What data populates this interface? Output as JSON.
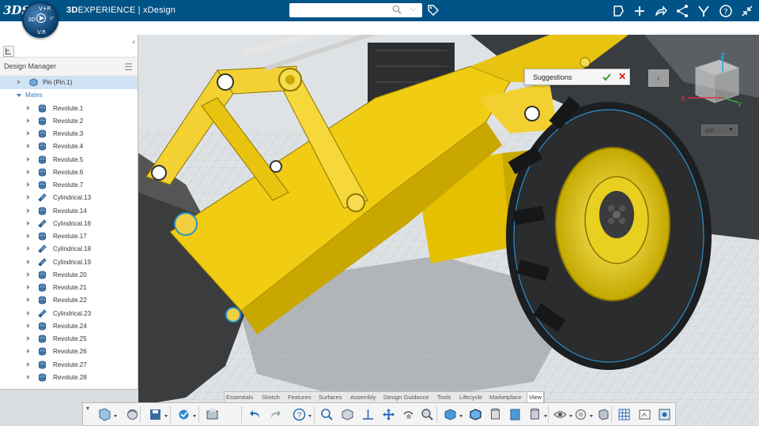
{
  "topbar": {
    "logo": "3DS",
    "brand_bold": "3D",
    "brand_rest": "EXPERIENCE | xDesign",
    "compass_labels": {
      "top": "V+R",
      "left": "3D",
      "right": "i³",
      "bottom": "V.R"
    },
    "search_placeholder": "",
    "icons": [
      "share-icon",
      "add-icon",
      "forward-icon",
      "network-icon",
      "tools-icon",
      "help-icon",
      "collapse-icon"
    ],
    "accent_color": "#005386"
  },
  "panel": {
    "title": "Design Manager",
    "root": "Pin (Pin.1)",
    "group": "Mates",
    "mates": [
      {
        "label": "Revolute.1",
        "type": "revolute"
      },
      {
        "label": "Revolute.2",
        "type": "revolute"
      },
      {
        "label": "Revolute.3",
        "type": "revolute"
      },
      {
        "label": "Revolute.4",
        "type": "revolute"
      },
      {
        "label": "Revolute.5",
        "type": "revolute"
      },
      {
        "label": "Revolute.6",
        "type": "revolute"
      },
      {
        "label": "Revolute.7",
        "type": "revolute"
      },
      {
        "label": "Cylindrical.13",
        "type": "cylindrical"
      },
      {
        "label": "Revolute.14",
        "type": "revolute"
      },
      {
        "label": "Cylindrical.16",
        "type": "cylindrical"
      },
      {
        "label": "Revolute.17",
        "type": "revolute"
      },
      {
        "label": "Cylindrical.18",
        "type": "cylindrical"
      },
      {
        "label": "Cylindrical.19",
        "type": "cylindrical"
      },
      {
        "label": "Revolute.20",
        "type": "revolute"
      },
      {
        "label": "Revolute.21",
        "type": "revolute"
      },
      {
        "label": "Revolute.22",
        "type": "revolute"
      },
      {
        "label": "Cylindrical.23",
        "type": "cylindrical"
      },
      {
        "label": "Revolute.24",
        "type": "revolute"
      },
      {
        "label": "Revolute.25",
        "type": "revolute"
      },
      {
        "label": "Revolute.26",
        "type": "revolute"
      },
      {
        "label": "Revolute.27",
        "type": "revolute"
      },
      {
        "label": "Revolute.28",
        "type": "revolute"
      }
    ]
  },
  "viewport": {
    "suggestions_label": "Suggestions",
    "units": "cm",
    "axes": {
      "x": "X",
      "y": "Y",
      "z": "Z"
    }
  },
  "actionbar": {
    "tabs": [
      "Essentials",
      "Sketch",
      "Features",
      "Surfaces",
      "Assembly",
      "Design Guidance",
      "Tools",
      "Lifecycle",
      "Marketplace",
      "View"
    ],
    "active_tab": "View"
  }
}
